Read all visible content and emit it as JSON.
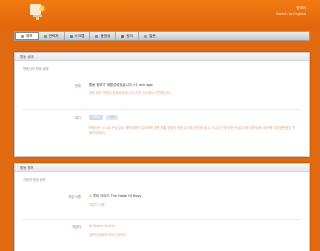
{
  "header": {
    "lang_current": "한국어",
    "lang_other": "Switch to English"
  },
  "nav": {
    "items": [
      {
        "label": "정보",
        "color": "#e0802a"
      },
      {
        "label": "연락처",
        "color": "#6aa84f"
      },
      {
        "label": "스크랩",
        "color": "#3d85c6"
      },
      {
        "label": "동영상",
        "color": "#8e7cc3"
      },
      {
        "label": "링크",
        "color": "#cc4125"
      },
      {
        "label": "질문",
        "color": "#999999"
      }
    ]
  },
  "status_panel": {
    "title": "활동 상태",
    "subtitle": "활동이의 현재 상태",
    "current_label": "현재",
    "current_value": "활동 정보가 재활성되었습니다 <1 min ago",
    "current_note": "활동 정보 재활성 완료되었습니다 (이력 인수에서 연견합니다)",
    "tags_label": "태그",
    "tags": [
      "인터넷",
      "기타"
    ],
    "tags_note": "활동하는 스스로 관심 분야 재활성화를 유지하며 재활 해결 방법이 적힌 분석을 참조해 둘 수 가고있진 한국형 관심분야에 재활성화 (재반응 분야명변동은 인용되어야요)"
  },
  "info_panel": {
    "title": "활동 정보",
    "subtitle": "가장의 작업 정보",
    "work_label": "작업 이름",
    "work_value": "루비 이야기 The Fable Of Ruby",
    "work_note": "작업자 이름",
    "work2_label": "작업자",
    "work2_value": "Robert Soutet",
    "work2_note": "참여자(방송국 하나) 참여자"
  }
}
